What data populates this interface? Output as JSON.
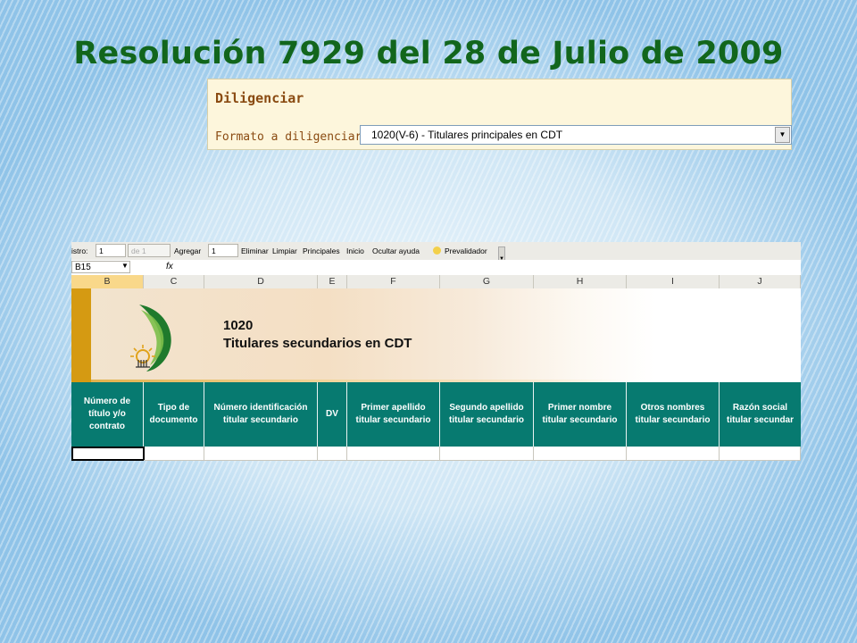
{
  "slide": {
    "title": "Resolución 7929 del 28 de Julio de 2009"
  },
  "diligenciar": {
    "title": "Diligenciar",
    "format_label": "Formato a diligenciar:",
    "selected_format": "1020(V-6) - Titulares principales en CDT"
  },
  "sheet": {
    "toolbar": {
      "registro_label": "istro:",
      "registro_value": "1",
      "de_value": "de 1",
      "agregar_label": "Agregar",
      "agregar_value": "1",
      "eliminar": "Eliminar",
      "limpiar": "Limpiar",
      "principales": "Principales",
      "inicio": "Inicio",
      "ocultar_ayuda": "Ocultar ayuda",
      "prevalidador": "Prevalidador"
    },
    "name_box": "B15",
    "fx_label": "fx",
    "columns": [
      "B",
      "C",
      "D",
      "E",
      "F",
      "G",
      "H",
      "I",
      "J"
    ],
    "banner": {
      "code": "1020",
      "name": "Titulares secundarios en CDT"
    },
    "headers": [
      "Número de\ntítulo y/o\ncontrato",
      "Tipo de\ndocumento",
      "Número identificación\ntitular secundario",
      "DV",
      "Primer apellido\ntitular secundario",
      "Segundo apellido\ntitular secundario",
      "Primer nombre\ntitular secundario",
      "Otros nombres\ntitular secundario",
      "Razón social\ntitular secundar"
    ]
  },
  "colors": {
    "title_green": "#12661c",
    "header_teal": "#077a70",
    "banner_orange": "#d59a12"
  }
}
